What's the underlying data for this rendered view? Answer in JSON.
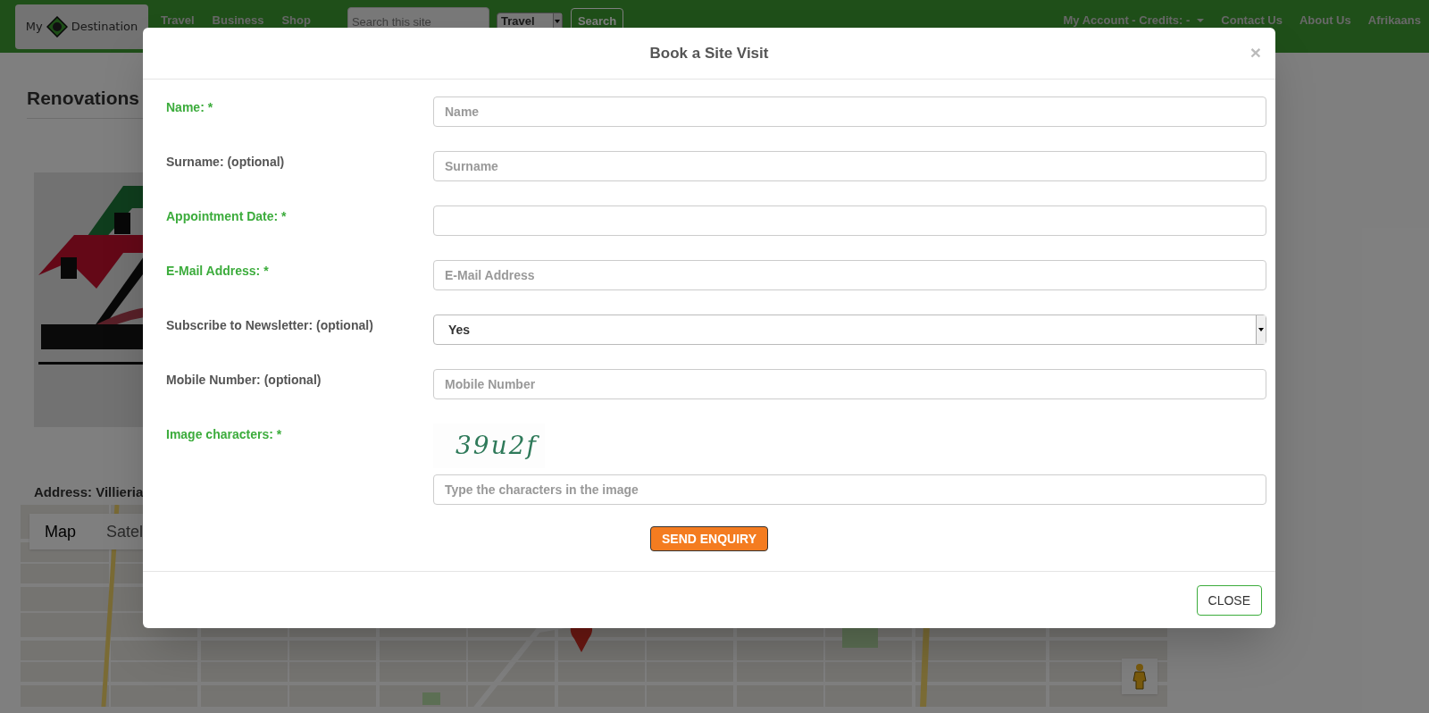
{
  "navbar": {
    "logo": {
      "word_1": "My",
      "word_2": "Destination"
    },
    "links": [
      "Travel",
      "Business",
      "Shop"
    ],
    "search": {
      "placeholder": "Search this site"
    },
    "category": {
      "value": "Travel"
    },
    "search_button": "Search",
    "right_links": [
      {
        "label": "My Account - Credits: -",
        "dropdown": true
      },
      {
        "label": "Contact Us",
        "dropdown": false
      },
      {
        "label": "About Us",
        "dropdown": false
      },
      {
        "label": "Afrikaans",
        "dropdown": false
      }
    ]
  },
  "page": {
    "heading": "Renovations",
    "address": "Address: Villieria",
    "map_types": [
      {
        "label": "Map",
        "selected": true
      },
      {
        "label": "Satel",
        "selected": false
      }
    ]
  },
  "modal": {
    "title": "Book a Site Visit",
    "close_symbol": "×",
    "fields": [
      {
        "kind": "input",
        "label": "Name: *",
        "required": true,
        "placeholder": "Name"
      },
      {
        "kind": "input",
        "label": "Surname: (optional)",
        "required": false,
        "placeholder": "Surname"
      },
      {
        "kind": "input",
        "label": "Appointment Date: *",
        "required": true
      },
      {
        "kind": "input",
        "label": "E-Mail Address: *",
        "required": true,
        "placeholder": "E-Mail Address"
      },
      {
        "kind": "select",
        "label": "Subscribe to Newsletter: (optional)",
        "required": false,
        "value": "Yes"
      },
      {
        "kind": "input",
        "label": "Mobile Number: (optional)",
        "required": false,
        "placeholder": "Mobile Number"
      },
      {
        "kind": "captcha",
        "label": "Image characters: *",
        "required": true,
        "captcha": "39u2f",
        "placeholder": "Type the characters in the image"
      }
    ],
    "send_button": "SEND ENQUIRY",
    "close_button": "CLOSE"
  }
}
